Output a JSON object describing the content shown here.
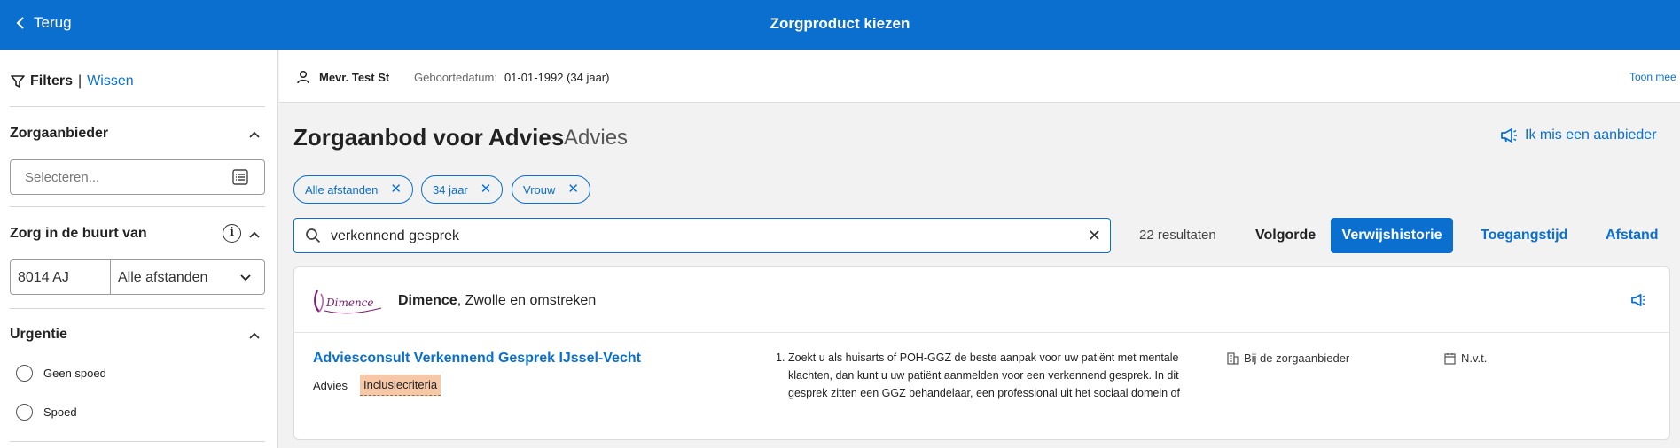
{
  "header": {
    "back_label": "Terug",
    "title": "Zorgproduct kiezen"
  },
  "sidebar": {
    "filters_label": "Filters",
    "separator": "|",
    "clear_label": "Wissen",
    "zorgaanbieder": {
      "title": "Zorgaanbieder",
      "placeholder": "Selecteren..."
    },
    "buurt": {
      "title": "Zorg in de buurt van",
      "postcode": "8014 AJ",
      "distance": "Alle afstanden"
    },
    "urgentie": {
      "title": "Urgentie",
      "options": [
        "Geen spoed",
        "Spoed"
      ]
    }
  },
  "patient": {
    "name": "Mevr. Test St",
    "dob_label": "Geboortedatum:",
    "dob_value": "01-01-1992 (34 jaar)",
    "more_label": "Toon mee"
  },
  "main": {
    "title": "Zorgaanbod voor Advies",
    "subtitle": "Advies",
    "missing_provider": "Ik mis een aanbieder",
    "chips": [
      "Alle afstanden",
      "34 jaar",
      "Vrouw"
    ],
    "search_value": "verkennend gesprek",
    "results": "22 resultaten",
    "sort_label": "Volgorde",
    "sort_options": [
      "Verwijshistorie",
      "Toegangstijd",
      "Afstand"
    ],
    "sort_active": "Verwijshistorie"
  },
  "card": {
    "provider_name": "Dimence",
    "provider_region": ", Zwolle en omstreken",
    "logo_text": "Dimence",
    "product_title": "Adviesconsult Verkennend Gesprek IJssel-Vecht",
    "product_type": "Advies",
    "badge": "Inclusiecriteria",
    "desc_number": "1.",
    "description": "Zoekt u als huisarts of POH-GGZ de beste aanpak voor uw patiënt met mentale klachten, dan kunt u uw patiënt aanmelden voor een verkennend gesprek. In dit gesprek zitten een GGZ behandelaar, een professional uit het sociaal domein of een ervaringsdeskundige samen met uw patiënt om de situatie te verkennen.",
    "location": "Bij de zorgaanbieder",
    "availability": "N.v.t."
  },
  "colors": {
    "primary": "#0a6fcf",
    "badge_bg": "#f7c8a8",
    "logo_purple": "#7a1f6b"
  }
}
